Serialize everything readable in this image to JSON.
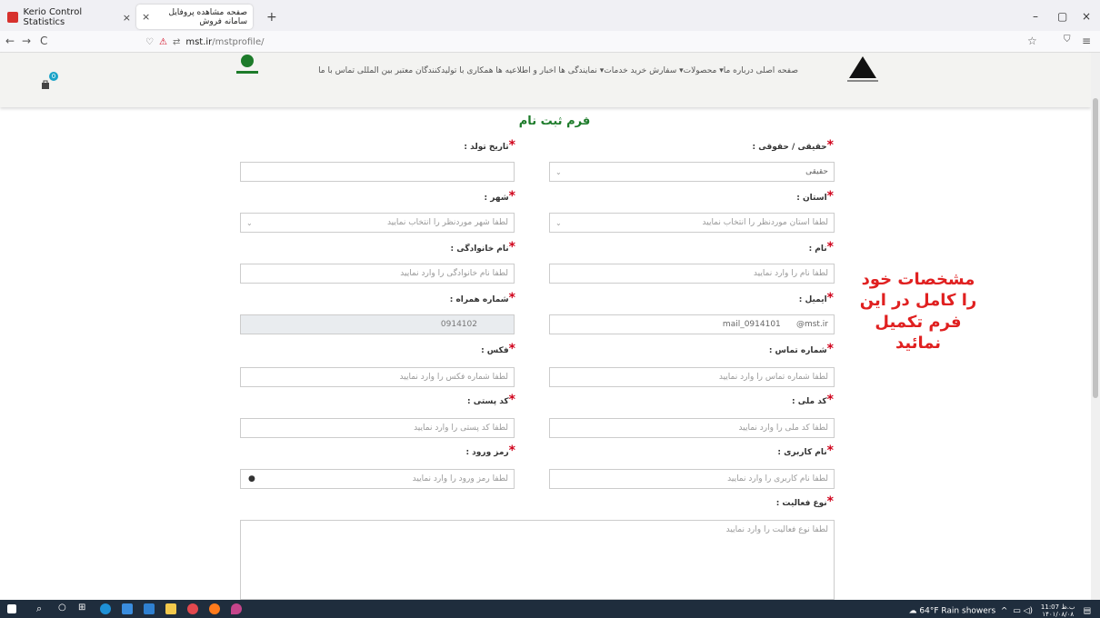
{
  "browser": {
    "tabs": [
      {
        "title": "Kerio Control Statistics",
        "close": "×"
      },
      {
        "title": "صفحه مشاهده پروفایل سامانه فروش",
        "close": "×"
      }
    ],
    "new_tab": "+",
    "window_controls": {
      "minimize": "–",
      "maximize": "▢",
      "close": "×"
    },
    "nav": {
      "back": "←",
      "forward": "→",
      "reload": "C"
    },
    "url_host": "mst.ir",
    "url_path": "/mstprofile/",
    "bookmark_icon": "☆",
    "pocket_icon": "⛉",
    "menu_icon": "≡"
  },
  "site": {
    "menu": "صفحه اصلی  درباره ما▾  محصولات▾  سفارش خرید  خدمات▾  نمایندگی ها  اخبار و اطلاعیه ها  همکاری با تولیدکنندگان معتبر بین المللی  تماس با ما",
    "cart_count": "0"
  },
  "form": {
    "title": "فرم ثبت نام",
    "legal_label": "حقیقی / حقوقی :",
    "legal_value": "حقیقی",
    "birth_label": "تاریخ تولد :",
    "birth_value": "",
    "province_label": "استان :",
    "province_placeholder": "لطفا استان موردنظر را انتخاب نمایید",
    "city_label": "شهر :",
    "city_placeholder": "لطفا شهر موردنظر را انتخاب نمایید",
    "name_label": "نام :",
    "name_placeholder": "لطفا نام را وارد نمایید",
    "family_label": "نام خانوادگی :",
    "family_placeholder": "لطفا نام خانوادگی را وارد نمایید",
    "email_label": "ایمیل :",
    "email_value": "mail_0914101      @mst.ir",
    "mobile_label": "شماره همراه :",
    "mobile_value": "0914102",
    "phone_label": "شماره تماس :",
    "phone_placeholder": "لطفا شماره تماس را وارد نمایید",
    "fax_label": "فکس :",
    "fax_placeholder": "لطفا شماره فکس را وارد نمایید",
    "national_label": "کد ملی :",
    "national_placeholder": "لطفا کد ملی را وارد نمایید",
    "postal_label": "کد پستی :",
    "postal_placeholder": "لطفا کد پستی را وارد نمایید",
    "username_label": "نام کاربری :",
    "username_placeholder": "لطفا نام کاربری را وارد نمایید",
    "password_label": "رمز ورود :",
    "password_placeholder": "لطفا رمز ورود را وارد نمایید",
    "activity_label": "نوع فعالیت :",
    "activity_placeholder": "لطفا نوع فعالیت را وارد نمایید",
    "star": "*"
  },
  "note": "مشخصات خود را کامل در این فرم تکمیل نمائید",
  "taskbar": {
    "weather": "64°F  Rain showers",
    "time": "11:07 ب.ظ",
    "date": "۱۴۰۱/۰۸/۰۸"
  }
}
